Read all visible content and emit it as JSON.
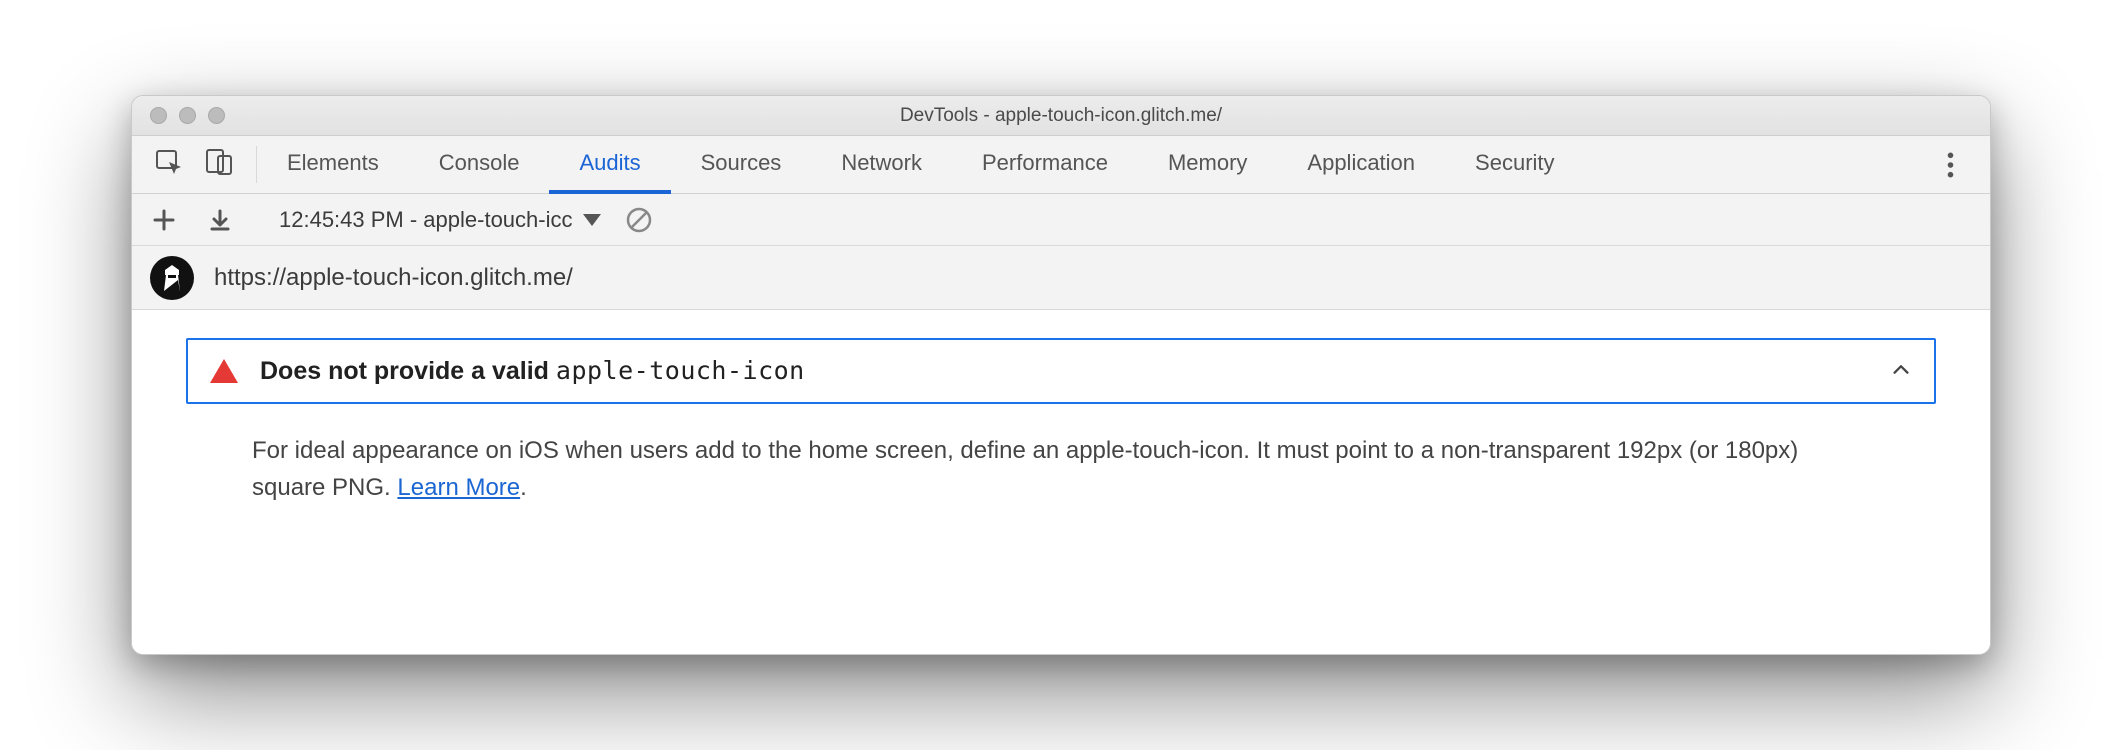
{
  "window": {
    "title": "DevTools - apple-touch-icon.glitch.me/"
  },
  "tabs": {
    "items": [
      "Elements",
      "Console",
      "Audits",
      "Sources",
      "Network",
      "Performance",
      "Memory",
      "Application",
      "Security"
    ],
    "active": "Audits"
  },
  "toolbar": {
    "report_label": "12:45:43 PM - apple-touch-icc"
  },
  "urlbar": {
    "url": "https://apple-touch-icon.glitch.me/"
  },
  "audit": {
    "title_prefix": "Does not provide a valid ",
    "title_code": "apple-touch-icon",
    "description_a": "For ideal appearance on iOS when users add to the home screen, define an apple-touch-icon. It must point to a non-transparent 192px (or 180px) square PNG. ",
    "learn_more": "Learn More",
    "description_b": "."
  }
}
